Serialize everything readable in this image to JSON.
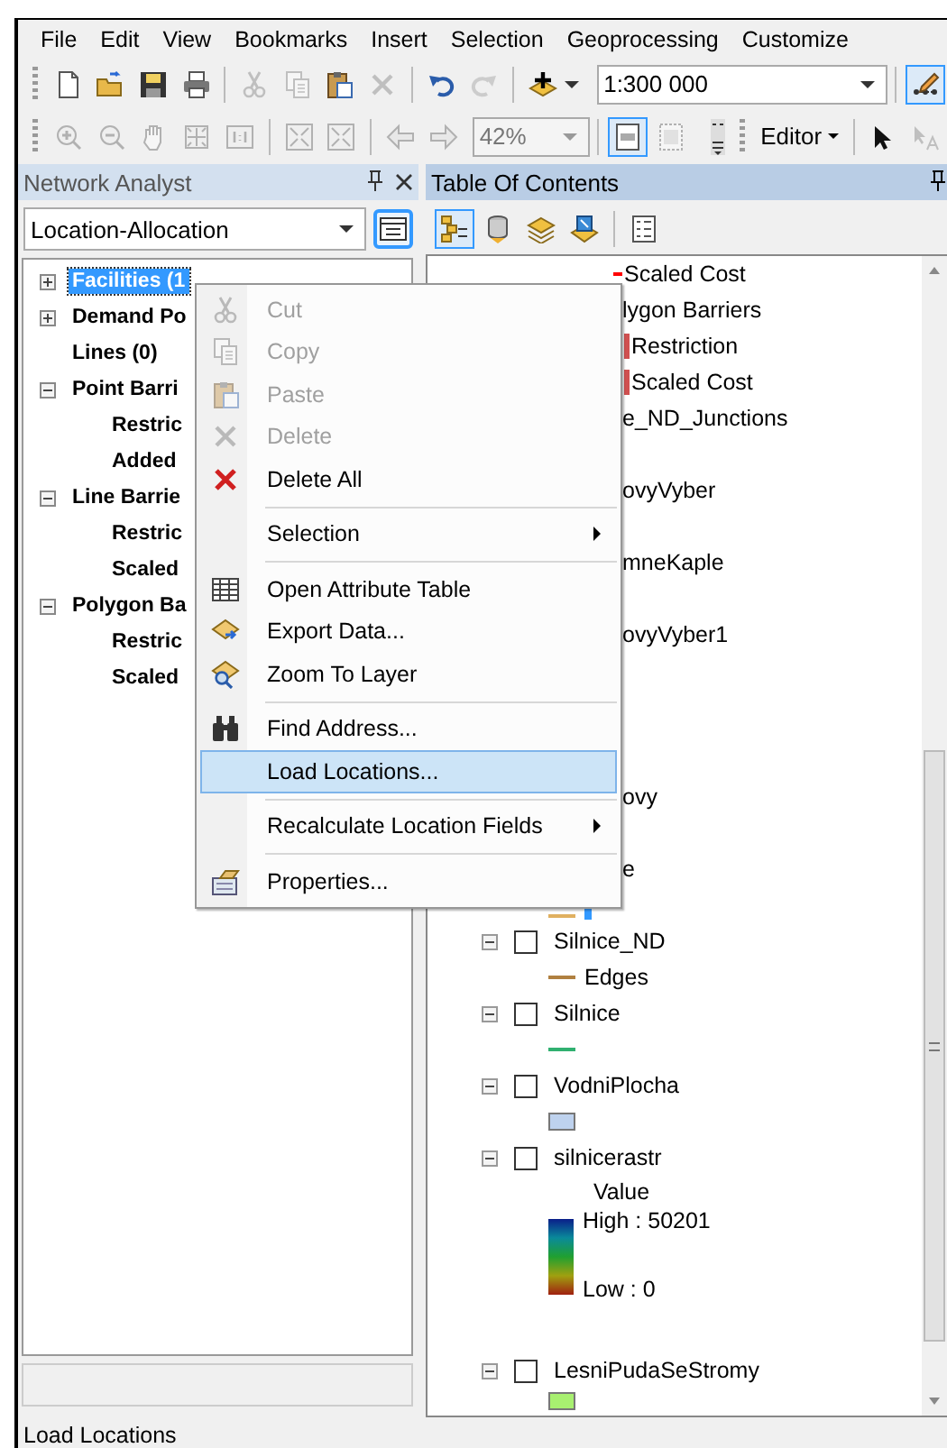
{
  "menu_bar": [
    "File",
    "Edit",
    "View",
    "Bookmarks",
    "Insert",
    "Selection",
    "Geoprocessing",
    "Customize"
  ],
  "standard_toolbar": {
    "groups": [
      [
        {
          "disabled": false,
          "pressed": false
        },
        {
          "disabled": false,
          "pressed": false
        },
        {
          "disabled": false,
          "pressed": false
        },
        {
          "disabled": false,
          "pressed": false
        }
      ],
      [
        {
          "disabled": true,
          "pressed": false
        },
        {
          "disabled": true,
          "pressed": false
        },
        {
          "disabled": false,
          "pressed": false
        },
        {
          "disabled": true,
          "pressed": false
        }
      ],
      [
        {
          "disabled": false,
          "pressed": false
        },
        {
          "disabled": true,
          "pressed": false
        }
      ],
      [
        {
          "disabled": false,
          "pressed": false
        }
      ]
    ],
    "scale": "1:300 000",
    "tool": {
      "disabled": false,
      "pressed": true
    }
  },
  "tools_toolbar": {
    "groups": [
      [
        {
          "disabled": true,
          "pressed": false
        },
        {
          "disabled": true,
          "pressed": false
        },
        {
          "disabled": true,
          "pressed": false
        },
        {
          "disabled": true,
          "pressed": false
        },
        {
          "disabled": true,
          "pressed": false
        }
      ],
      [
        {
          "disabled": true,
          "pressed": false
        },
        {
          "disabled": true,
          "pressed": false
        }
      ],
      [
        {
          "disabled": true,
          "pressed": false
        },
        {
          "disabled": true,
          "pressed": false
        }
      ]
    ],
    "zoom": {
      "value": "42%",
      "disabled": true
    },
    "toggles": [
      {
        "disabled": false,
        "pressed": true
      },
      {
        "disabled": true,
        "pressed": false
      }
    ],
    "editor": "Editor",
    "edit_tools": [
      {
        "disabled": false,
        "pressed": false
      },
      {
        "disabled": true,
        "pressed": false
      }
    ]
  },
  "network_analyst": {
    "title": "Network Analyst",
    "active": false,
    "solver": "Location-Allocation",
    "tree": [
      {
        "label": "Facilities (1",
        "expanded": false,
        "selected": true
      },
      {
        "label": "Demand Po",
        "expanded": false,
        "selected": false
      },
      {
        "label": "Lines (0)",
        "selected": false
      },
      {
        "label": "Point Barri",
        "expanded": true,
        "selected": false,
        "children": [
          {
            "label": "Restric",
            "selected": false
          },
          {
            "label": "Added",
            "selected": false
          }
        ]
      },
      {
        "label": "Line Barrie",
        "expanded": true,
        "selected": false,
        "children": [
          {
            "label": "Restric",
            "selected": false
          },
          {
            "label": "Scaled",
            "selected": false
          }
        ]
      },
      {
        "label": "Polygon Ba",
        "expanded": true,
        "selected": false,
        "children": [
          {
            "label": "Restric",
            "selected": false
          },
          {
            "label": "Scaled",
            "selected": false
          }
        ]
      }
    ]
  },
  "table_of_contents": {
    "title": "Table Of Contents",
    "active": true,
    "views": [
      {
        "pressed": true
      },
      {
        "pressed": false
      },
      {
        "pressed": false
      },
      {
        "pressed": false
      }
    ],
    "items_top": [
      {
        "kind": "line_label",
        "text": "Scaled Cost",
        "color": "#ff0000"
      },
      {
        "kind": "partial_group",
        "text": "lygon Barriers"
      },
      {
        "kind": "patch_label",
        "text": "Restriction",
        "color": "#d05050"
      },
      {
        "kind": "patch_label",
        "text": "Scaled Cost",
        "color": "#d05050"
      },
      {
        "kind": "partial_name",
        "text": "e_ND_Junctions"
      },
      {
        "kind": "partial_name",
        "text": "ovyVyber"
      },
      {
        "kind": "partial_name",
        "text": "mneKaple"
      },
      {
        "kind": "partial_name",
        "text": "ovyVyber1"
      }
    ],
    "items_bottom": [
      {
        "kind": "partial_name",
        "text": "ovy"
      },
      {
        "kind": "partial_group",
        "text": "e"
      },
      {
        "kind": "legend_bar",
        "color": "#3399ff",
        "line": {
          "color": "#e0b060"
        }
      },
      {
        "kind": "layer",
        "name": "Silnice_ND",
        "expanded": true,
        "checked": false
      },
      {
        "kind": "legend_line",
        "label": "Edges",
        "color": "#b08040"
      },
      {
        "kind": "layer",
        "name": "Silnice",
        "expanded": true,
        "checked": false
      },
      {
        "kind": "legend_line",
        "color": "#30b070"
      },
      {
        "kind": "layer",
        "name": "VodniPlocha",
        "expanded": true,
        "checked": false
      },
      {
        "kind": "legend_fill",
        "color": "#bed2ee"
      },
      {
        "kind": "layer",
        "name": "silnicerastr",
        "expanded": true,
        "checked": false
      },
      {
        "kind": "ramp_title",
        "text": "Value"
      },
      {
        "kind": "ramp",
        "high": "High : 50201",
        "low": "Low : 0"
      },
      {
        "kind": "layer",
        "name": "LesniPudaSeStromy",
        "expanded": true,
        "checked": false
      },
      {
        "kind": "legend_fill",
        "color": "#a8f070"
      }
    ]
  },
  "context_menu": [
    {
      "kind": "item",
      "label": "Cut",
      "disabled": true,
      "selected": false
    },
    {
      "kind": "item",
      "label": "Copy",
      "disabled": true,
      "selected": false
    },
    {
      "kind": "item",
      "label": "Paste",
      "disabled": true,
      "selected": false
    },
    {
      "kind": "item",
      "label": "Delete",
      "disabled": true,
      "selected": false
    },
    {
      "kind": "item",
      "label": "Delete All",
      "disabled": false,
      "selected": false
    },
    {
      "kind": "separator"
    },
    {
      "kind": "submenu",
      "label": "Selection",
      "disabled": false,
      "selected": false
    },
    {
      "kind": "separator"
    },
    {
      "kind": "item",
      "label": "Open Attribute Table",
      "disabled": false,
      "selected": false
    },
    {
      "kind": "item",
      "label": "Export Data...",
      "disabled": false,
      "selected": false
    },
    {
      "kind": "item",
      "label": "Zoom To Layer",
      "disabled": false,
      "selected": false
    },
    {
      "kind": "separator"
    },
    {
      "kind": "item",
      "label": "Find Address...",
      "disabled": false,
      "selected": false
    },
    {
      "kind": "item",
      "label": "Load Locations...",
      "disabled": false,
      "selected": true
    },
    {
      "kind": "separator"
    },
    {
      "kind": "submenu",
      "label": "Recalculate Location Fields",
      "disabled": false,
      "selected": false
    },
    {
      "kind": "separator"
    },
    {
      "kind": "item",
      "label": "Properties...",
      "disabled": false,
      "selected": false
    }
  ],
  "status_bar": "Load Locations"
}
